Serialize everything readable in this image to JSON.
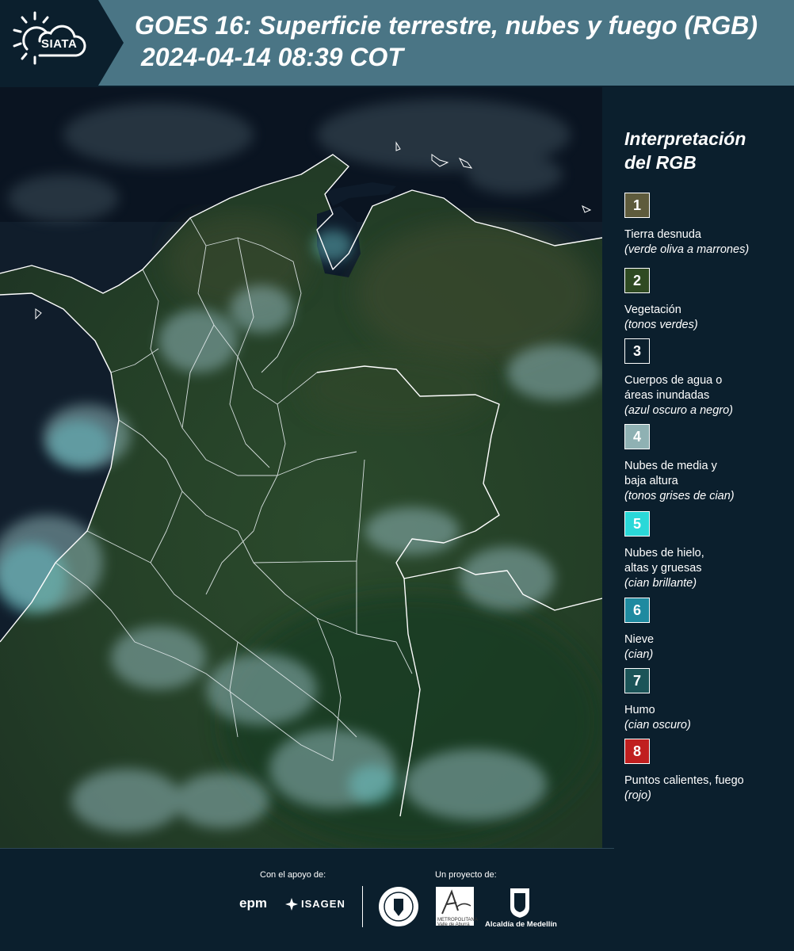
{
  "header": {
    "logo_text": "SIATA",
    "title_line1": "GOES 16: Superficie terrestre, nubes y fuego (RGB)",
    "title_line2": "2024-04-14 08:39 COT"
  },
  "map": {
    "image_type": "satellite-rgb-composite",
    "region": "Colombia"
  },
  "legend": {
    "title_line1": "Interpretación",
    "title_line2": "del RGB",
    "items": [
      {
        "num": "1",
        "label": "Tierra desnuda",
        "sub": "(verde oliva a marrones)",
        "color": "#5e5b3c"
      },
      {
        "num": "2",
        "label": "Vegetación",
        "sub": "(tonos verdes)",
        "color": "#2f4a22"
      },
      {
        "num": "3",
        "label": "Cuerpos de agua o áreas inundadas",
        "sub": "(azul oscuro a negro)",
        "color": "#0b1f2d"
      },
      {
        "num": "4",
        "label": "Nubes de media y baja altura",
        "sub": "(tonos grises de cian)",
        "color": "#8fb1b3"
      },
      {
        "num": "5",
        "label": "Nubes de hielo, altas y gruesas",
        "sub": "(cian brillante)",
        "color": "#2ad8d8"
      },
      {
        "num": "6",
        "label": "Nieve",
        "sub": "(cian)",
        "color": "#1f8aa0"
      },
      {
        "num": "7",
        "label": "Humo",
        "sub": "(cian oscuro)",
        "color": "#1b5458"
      },
      {
        "num": "8",
        "label": "Puntos calientes, fuego",
        "sub": "(rojo)",
        "color": "#c01f1f"
      }
    ]
  },
  "footer": {
    "support_caption": "Con el apoyo de:",
    "project_caption": "Un proyecto de:",
    "epm": "epm",
    "isagen": "ISAGEN",
    "alcaldia": "Alcaldía de Medellín",
    "area_logo_lines": [
      "METROPOLITANA",
      "Valle de Aburrá"
    ]
  }
}
